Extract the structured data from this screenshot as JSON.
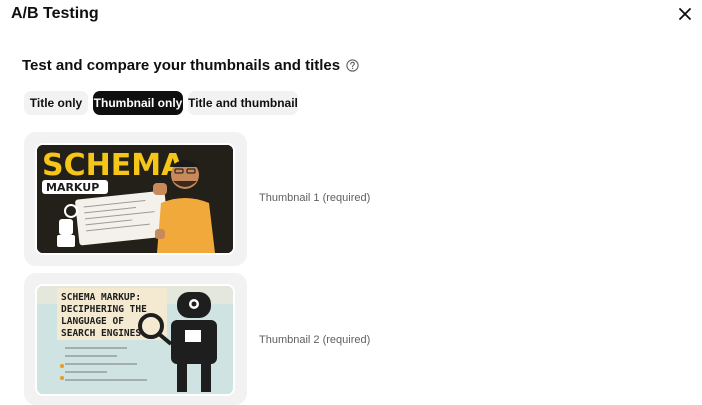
{
  "dialog": {
    "title": "A/B Testing"
  },
  "section": {
    "heading": "Test and compare your thumbnails and titles"
  },
  "tabs": [
    {
      "label": "Title only",
      "active": false
    },
    {
      "label": "Thumbnail only",
      "active": true
    },
    {
      "label": "Title and thumbnail",
      "active": false
    }
  ],
  "thumbnails": [
    {
      "label": "Thumbnail 1 (required)",
      "art_text": {
        "line1": "SCHEMA",
        "line2": "MARKUP"
      }
    },
    {
      "label": "Thumbnail 2 (required)",
      "art_text": {
        "line1": "SCHEMA MARKUP:",
        "line2": "DECIPHERING THE",
        "line3": "LANGUAGE OF",
        "line4": "SEARCH ENGINES"
      }
    }
  ],
  "colors": {
    "active_chip_bg": "#0f0f0f",
    "chip_bg": "#f2f2f2",
    "card_bg": "#f2f2f2",
    "thumb1_accent": "#f5c518",
    "thumb2_bg": "#cfe3e2"
  }
}
